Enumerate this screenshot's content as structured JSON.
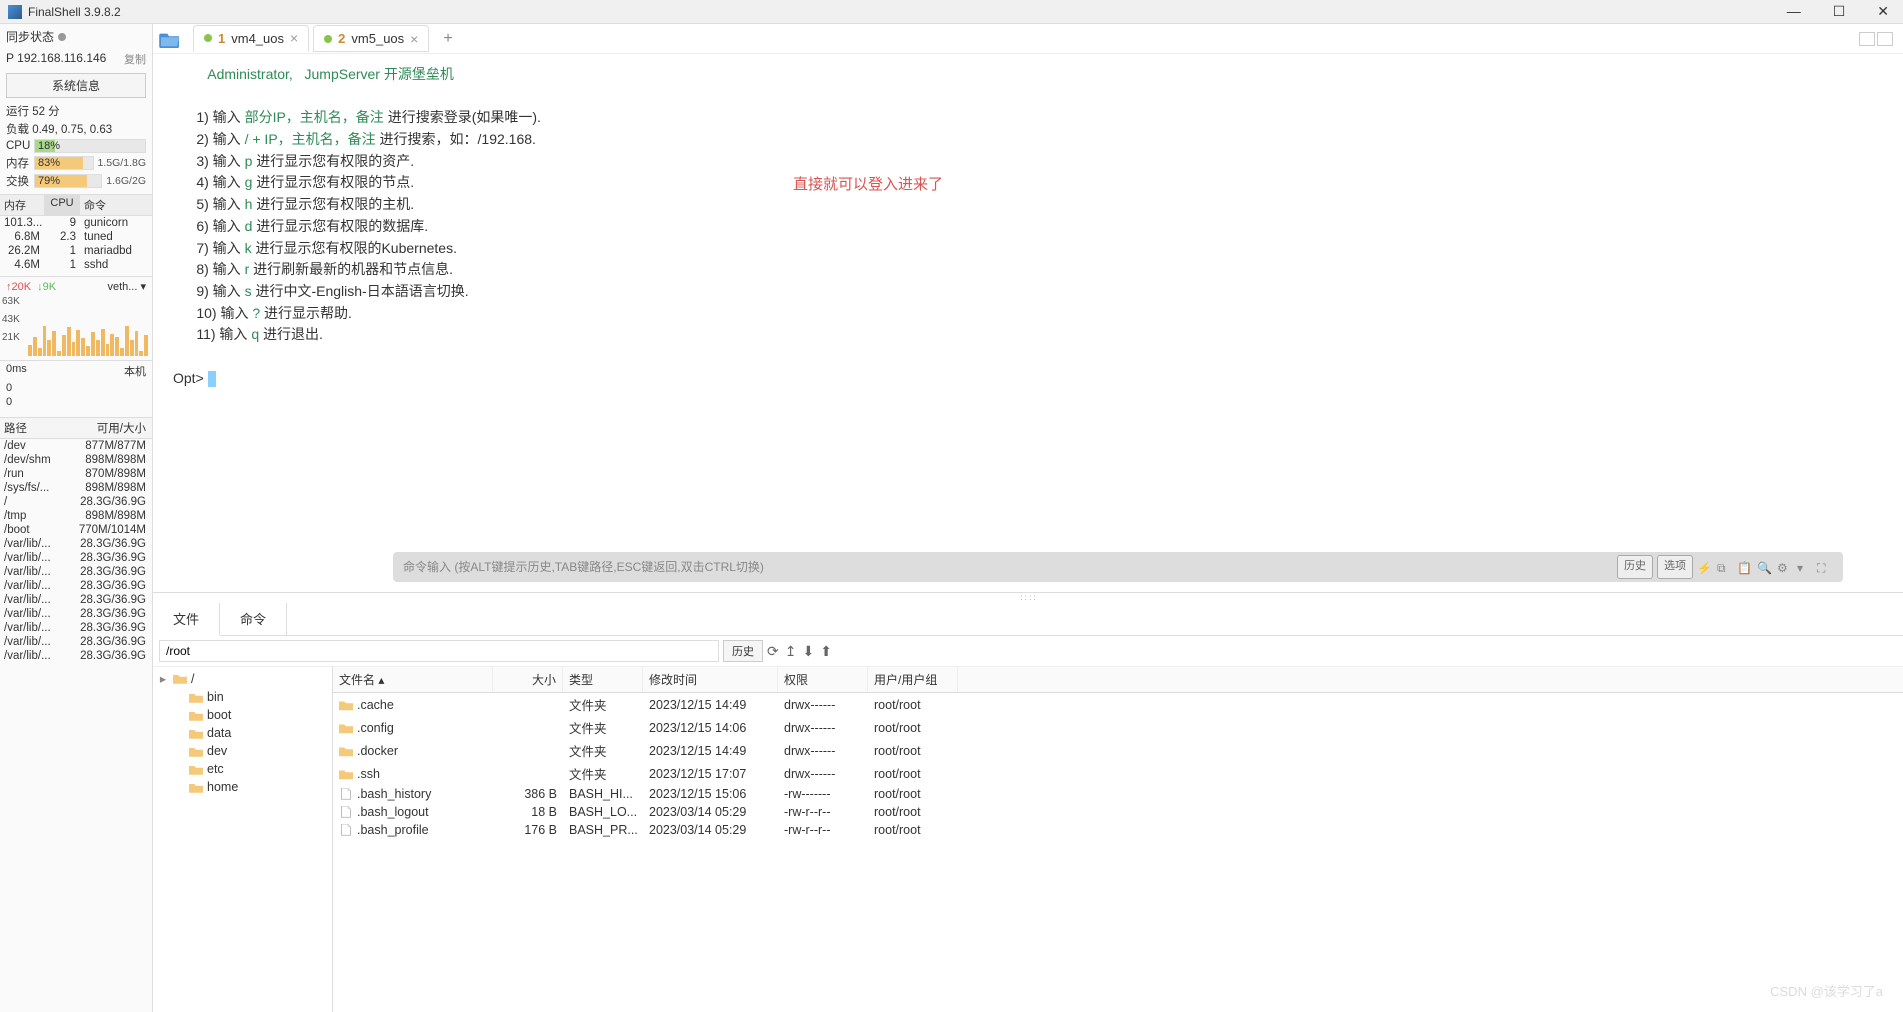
{
  "app": {
    "title": "FinalShell 3.9.8.2"
  },
  "window_controls": {
    "min": "—",
    "max": "☐",
    "close": "✕"
  },
  "sidebar": {
    "sync_label": "同步状态",
    "ip_prefix": "P",
    "ip": "192.168.116.146",
    "copy": "复制",
    "sysinfo_btn": "系统信息",
    "uptime": "运行 52 分",
    "load": "负载 0.49, 0.75, 0.63",
    "cpu": {
      "label": "CPU",
      "pct": "18%",
      "width": "18%"
    },
    "mem": {
      "label": "内存",
      "pct": "83%",
      "detail": "1.5G/1.8G",
      "width": "83%"
    },
    "swap": {
      "label": "交换",
      "pct": "79%",
      "detail": "1.6G/2G",
      "width": "79%"
    },
    "proc_headers": {
      "mem": "内存",
      "cpu": "CPU",
      "cmd": "命令"
    },
    "processes": [
      {
        "mem": "101.3...",
        "cpu": "9",
        "cmd": "gunicorn"
      },
      {
        "mem": "6.8M",
        "cpu": "2.3",
        "cmd": "tuned"
      },
      {
        "mem": "26.2M",
        "cpu": "1",
        "cmd": "mariadbd"
      },
      {
        "mem": "4.6M",
        "cpu": "1",
        "cmd": "sshd"
      }
    ],
    "net": {
      "up": "↑20K",
      "down": "↓9K",
      "iface": "veth... ▾",
      "y1": "63K",
      "y2": "43K",
      "y3": "21K"
    },
    "latency": {
      "left": "0ms",
      "right": "本机",
      "v1": "0",
      "v2": "0"
    },
    "disk_headers": {
      "path": "路径",
      "free": "可用/大小"
    },
    "disks": [
      {
        "path": "/dev",
        "free": "877M/877M"
      },
      {
        "path": "/dev/shm",
        "free": "898M/898M"
      },
      {
        "path": "/run",
        "free": "870M/898M"
      },
      {
        "path": "/sys/fs/...",
        "free": "898M/898M"
      },
      {
        "path": "/",
        "free": "28.3G/36.9G"
      },
      {
        "path": "/tmp",
        "free": "898M/898M"
      },
      {
        "path": "/boot",
        "free": "770M/1014M"
      },
      {
        "path": "/var/lib/...",
        "free": "28.3G/36.9G"
      },
      {
        "path": "/var/lib/...",
        "free": "28.3G/36.9G"
      },
      {
        "path": "/var/lib/...",
        "free": "28.3G/36.9G"
      },
      {
        "path": "/var/lib/...",
        "free": "28.3G/36.9G"
      },
      {
        "path": "/var/lib/...",
        "free": "28.3G/36.9G"
      },
      {
        "path": "/var/lib/...",
        "free": "28.3G/36.9G"
      },
      {
        "path": "/var/lib/...",
        "free": "28.3G/36.9G"
      },
      {
        "path": "/var/lib/...",
        "free": "28.3G/36.9G"
      },
      {
        "path": "/var/lib/...",
        "free": "28.3G/36.9G"
      }
    ]
  },
  "tabs": [
    {
      "num": "1",
      "label": "vm4_uos"
    },
    {
      "num": "2",
      "label": "vm5_uos"
    }
  ],
  "add_tab": "+",
  "terminal": {
    "header_user": "Administrator,",
    "header_srv": "JumpServer 开源堡垒机",
    "lines": [
      {
        "pre": "1) 输入 ",
        "hl": "部分IP，主机名，备注",
        "post": " 进行搜索登录(如果唯一)."
      },
      {
        "pre": "2) 输入 ",
        "hl": "/ + IP，主机名，备注",
        "post": " 进行搜索，如：/192.168."
      },
      {
        "pre": "3) 输入 ",
        "hl": "p",
        "post": " 进行显示您有权限的资产."
      },
      {
        "pre": "4) 输入 ",
        "hl": "g",
        "post": " 进行显示您有权限的节点."
      },
      {
        "pre": "5) 输入 ",
        "hl": "h",
        "post": " 进行显示您有权限的主机."
      },
      {
        "pre": "6) 输入 ",
        "hl": "d",
        "post": " 进行显示您有权限的数据库."
      },
      {
        "pre": "7) 输入 ",
        "hl": "k",
        "post": " 进行显示您有权限的Kubernetes."
      },
      {
        "pre": "8) 输入 ",
        "hl": "r",
        "post": " 进行刷新最新的机器和节点信息."
      },
      {
        "pre": "9) 输入 ",
        "hl": "s",
        "post": " 进行中文-English-日本語语言切换."
      },
      {
        "pre": "10) 输入 ",
        "hl": "?",
        "post": " 进行显示帮助."
      },
      {
        "pre": "11) 输入 ",
        "hl": "q",
        "post": " 进行退出."
      }
    ],
    "prompt": "Opt> ",
    "annotation": "直接就可以登入进来了"
  },
  "cmdbar": {
    "placeholder": "命令输入 (按ALT键提示历史,TAB键路径,ESC键返回,双击CTRL切换)",
    "history_btn": "历史",
    "options_btn": "选项"
  },
  "lower": {
    "tab_file": "文件",
    "tab_cmd": "命令",
    "path": "/root",
    "history_btn": "历史",
    "tree_root": "/",
    "tree": [
      "bin",
      "boot",
      "data",
      "dev",
      "etc",
      "home"
    ],
    "headers": {
      "name": "文件名 ▴",
      "size": "大小",
      "type": "类型",
      "date": "修改时间",
      "perm": "权限",
      "user": "用户/用户组"
    },
    "files": [
      {
        "name": ".cache",
        "size": "",
        "type": "文件夹",
        "date": "2023/12/15 14:49",
        "perm": "drwx------",
        "user": "root/root",
        "folder": true
      },
      {
        "name": ".config",
        "size": "",
        "type": "文件夹",
        "date": "2023/12/15 14:06",
        "perm": "drwx------",
        "user": "root/root",
        "folder": true
      },
      {
        "name": ".docker",
        "size": "",
        "type": "文件夹",
        "date": "2023/12/15 14:49",
        "perm": "drwx------",
        "user": "root/root",
        "folder": true
      },
      {
        "name": ".ssh",
        "size": "",
        "type": "文件夹",
        "date": "2023/12/15 17:07",
        "perm": "drwx------",
        "user": "root/root",
        "folder": true
      },
      {
        "name": ".bash_history",
        "size": "386 B",
        "type": "BASH_HI...",
        "date": "2023/12/15 15:06",
        "perm": "-rw-------",
        "user": "root/root",
        "folder": false
      },
      {
        "name": ".bash_logout",
        "size": "18 B",
        "type": "BASH_LO...",
        "date": "2023/03/14 05:29",
        "perm": "-rw-r--r--",
        "user": "root/root",
        "folder": false
      },
      {
        "name": ".bash_profile",
        "size": "176 B",
        "type": "BASH_PR...",
        "date": "2023/03/14 05:29",
        "perm": "-rw-r--r--",
        "user": "root/root",
        "folder": false
      }
    ]
  },
  "watermark": "CSDN @该学习了a"
}
